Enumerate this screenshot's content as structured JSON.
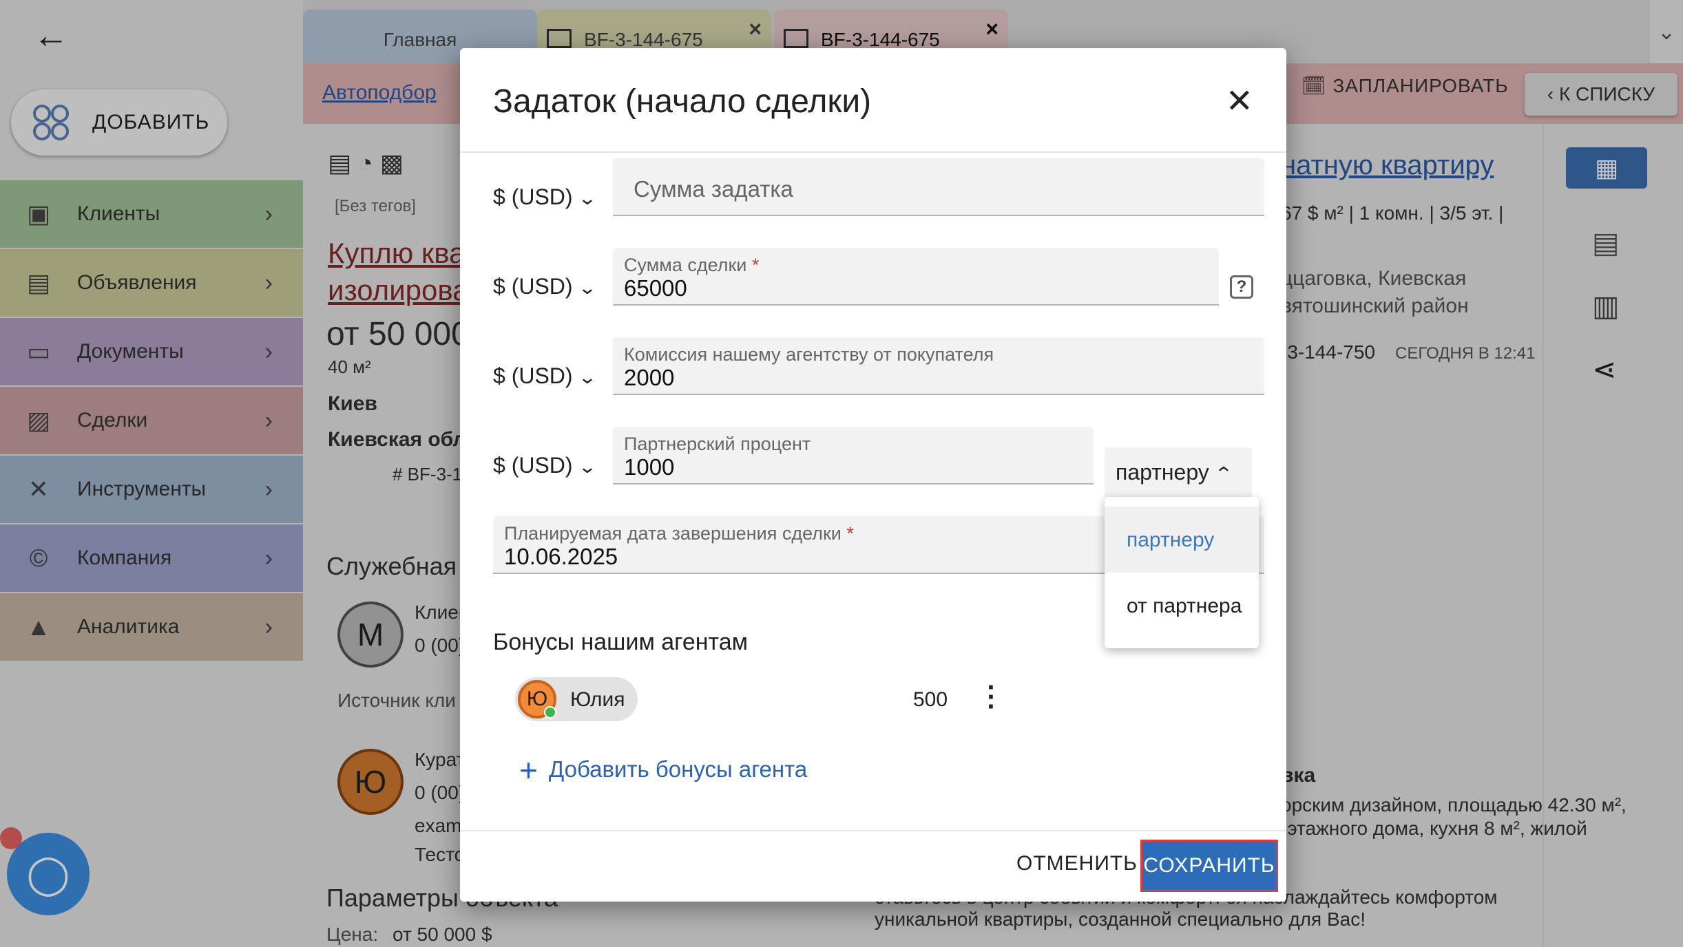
{
  "app": {
    "add_button": "ДОБАВИТЬ",
    "sidebar": [
      {
        "label": "Клиенты",
        "color": "#a3c59a",
        "icon": "▣"
      },
      {
        "label": "Объявления",
        "color": "#cbcb9c",
        "icon": "▤"
      },
      {
        "label": "Документы",
        "color": "#b3a0c6",
        "icon": "▭"
      },
      {
        "label": "Сделки",
        "color": "#c9a1a1",
        "icon": "▨"
      },
      {
        "label": "Инструменты",
        "color": "#9fb6cd",
        "icon": "✕"
      },
      {
        "label": "Компания",
        "color": "#9ea5cf",
        "icon": "©"
      },
      {
        "label": "Аналитика",
        "color": "#c8b5a6",
        "icon": "▲"
      }
    ],
    "tabs": [
      {
        "label": "Главная"
      },
      {
        "label": "BF-3-144-675",
        "close": "×"
      },
      {
        "label": "BF-3-144-675",
        "close": "×"
      }
    ],
    "link_autopodbor": "Автоподбор",
    "plan_button": "ЗАПЛАНИРОВАТЬ",
    "to_list_button": "К СПИСКУ",
    "bg": {
      "tags": "[Без тегов]",
      "title_line1": "Куплю ква",
      "title_line2": "изолирова",
      "price": "от 50 000",
      "area": "40 м²",
      "city": "Киев",
      "region": "Киевская обл",
      "id": "# BF-3-1",
      "service": "Служебная и",
      "client_avatar": "М",
      "client_name": "Клиен",
      "client_sub": "0 (00)",
      "source": "Источник кли",
      "curator_avatar": "Ю",
      "curator_name": "Курат",
      "curator_sub": "0 (00)",
      "curator_email": "exam",
      "curator_test": "Тесто",
      "params": "Параметры объекта",
      "price_line_label": "Цена:",
      "price_line_value": "от 50 000 $",
      "right_title": "натную квартиру",
      "right_meta": "67 $ м² | 1 комн. | 3/5 эт. |",
      "right_loc1": "ццаговка, Киевская",
      "right_loc2": "вятошинский район",
      "right_id": "-3-144-750",
      "right_time": "СЕГОДНЯ В 12:41",
      "desc_h": "вка",
      "desc1": "орским дизайном, площадью 42.30 м²,",
      "desc2": "-этажного дома, кухня 8 м², жилой",
      "desc3": "ставьтесь в центр событий и комфорт!   оя наслаждайтесь комфортом",
      "desc4": "уникальной квартиры, созданной специально для Вас!"
    }
  },
  "modal": {
    "title": "Задаток (начало сделки)",
    "close": "✕",
    "currency_label": "$ (USD)",
    "fields": {
      "deposit": {
        "placeholder": "Сумма задатка"
      },
      "deal_sum": {
        "label": "Сумма сделки",
        "required": "*",
        "value": "65000"
      },
      "commission": {
        "label": "Комиссия нашему агентству от покупателя",
        "value": "2000"
      },
      "partner_percent": {
        "label": "Партнерский процент",
        "value": "1000"
      },
      "planned_date": {
        "label": "Планируемая дата завершения сделки",
        "required": "*",
        "value": "10.06.2025"
      }
    },
    "help": "?",
    "partner_select": {
      "value": "партнеру",
      "options": [
        "партнеру",
        "от партнера"
      ]
    },
    "bonuses_title": "Бонусы нашим агентам",
    "agent": {
      "initial": "Ю",
      "name": "Юлия",
      "amount": "500"
    },
    "add_bonus": "Добавить бонусы агента",
    "cancel": "ОТМЕНИТЬ",
    "save": "СОХРАНИТЬ"
  },
  "colors": {
    "accent": "#2d6cb9",
    "highlight_border": "#e23b3b",
    "link": "#2c61b0"
  }
}
